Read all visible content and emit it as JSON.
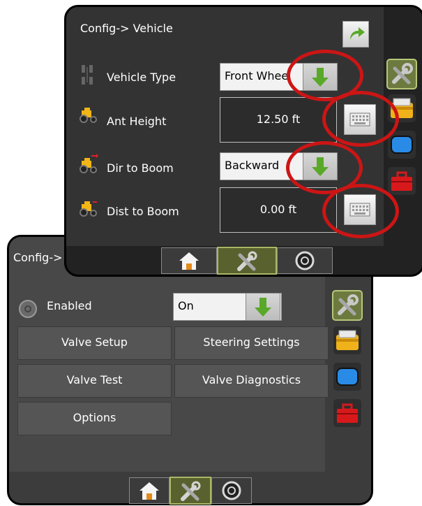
{
  "back_screen": {
    "title": "Config->",
    "enabled_label": "Enabled",
    "enabled_value": "On",
    "buttons": [
      "Valve Setup",
      "Steering Settings",
      "Valve Test",
      "Valve Diagnostics",
      "Options"
    ]
  },
  "front_screen": {
    "title": "Config-> Vehicle",
    "rows": [
      {
        "label": "Vehicle Type",
        "value": "Front Whee"
      },
      {
        "label": "Ant Height",
        "value": "12.50 ft"
      },
      {
        "label": "Dir to Boom",
        "value": "Backward"
      },
      {
        "label": "Dist to Boom",
        "value": "0.00 ft"
      }
    ]
  },
  "icons": {
    "return": "return-arrow-icon",
    "tools": "tools-icon",
    "folder": "folder-icon",
    "screen": "screen-icon",
    "toolbox": "toolbox-icon",
    "home": "home-icon",
    "gauge": "gauge-icon",
    "keyboard": "keyboard-icon",
    "down_arrow": "down-arrow-icon"
  },
  "colors": {
    "highlight_ring": "#cc1515",
    "selected_tab": "#6d7a3f",
    "arrow_green": "#5aa829"
  }
}
